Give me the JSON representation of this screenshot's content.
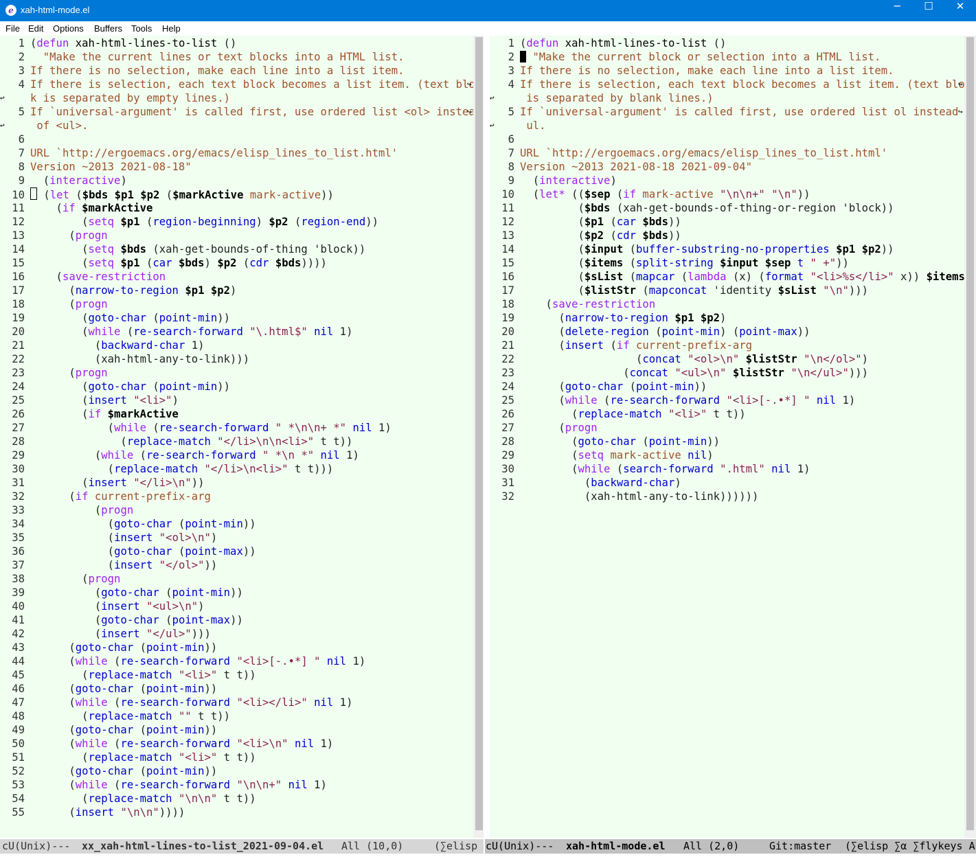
{
  "window": {
    "title": "xah-html-mode.el",
    "icon": "emacs-icon",
    "buttons": {
      "minimize": "─",
      "maximize": "☐",
      "close": "✕"
    }
  },
  "menubar": [
    "File",
    "Edit",
    "Options",
    "Buffers",
    "Tools",
    "Help"
  ],
  "left": {
    "lines": [
      {
        "n": "1",
        "h": "(<span class=\"k\">defun</span> <span class=\"f\">xah-html-lines-to-list</span> ()"
      },
      {
        "n": "2",
        "h": "  <span class=\"d\">\"Make the current lines or text blocks into a HTML list.</span>"
      },
      {
        "n": "3",
        "h": "<span class=\"d\">If there is no selection, make each line into a list item.</span>"
      },
      {
        "n": "4",
        "h": "<span class=\"d\">If there is selection, each text block becomes a list item. (text bloc</span>"
      },
      {
        "n": "",
        "h": "<span class=\"d\">k is separated by empty lines.)</span>"
      },
      {
        "n": "5",
        "h": "<span class=\"d\">If `universal-argument' is called first, use ordered list &lt;ol&gt; instead</span>"
      },
      {
        "n": "",
        "h": "<span class=\"d\"> of &lt;ul&gt;.</span>"
      },
      {
        "n": "6",
        "h": ""
      },
      {
        "n": "7",
        "h": "<span class=\"d\">URL `http://ergoemacs.org/emacs/elisp_lines_to_list.html'</span>"
      },
      {
        "n": "8",
        "h": "<span class=\"d\">Version ~2013 2021-08-18\"</span>"
      },
      {
        "n": "9",
        "h": "  (<span class=\"k\">interactive</span>)"
      },
      {
        "n": "10",
        "h": "<span class=\"cursor-box\"></span> (<span class=\"k\">let</span> (<span class=\"v\">$bds $p1 $p2</span> (<span class=\"v\">$markActive</span> <span class=\"d\">mark-active</span>))"
      },
      {
        "n": "11",
        "h": "    (<span class=\"k\">if</span> <span class=\"v\">$markActive</span>"
      },
      {
        "n": "12",
        "h": "        (<span class=\"k\">setq</span> <span class=\"v\">$p1</span> (<span class=\"b\">region-beginning</span>) <span class=\"v\">$p2</span> (<span class=\"b\">region-end</span>))"
      },
      {
        "n": "13",
        "h": "      (<span class=\"k\">progn</span>"
      },
      {
        "n": "14",
        "h": "        (<span class=\"k\">setq</span> <span class=\"v\">$bds</span> (xah-get-bounds-of-thing 'block))"
      },
      {
        "n": "15",
        "h": "        (<span class=\"k\">setq</span> <span class=\"v\">$p1</span> (<span class=\"b\">car</span> <span class=\"v\">$bds</span>) <span class=\"v\">$p2</span> (<span class=\"b\">cdr</span> <span class=\"v\">$bds</span>))))"
      },
      {
        "n": "16",
        "h": "    (<span class=\"k\">save-restriction</span>"
      },
      {
        "n": "17",
        "h": "      (<span class=\"b\">narrow-to-region</span> <span class=\"v\">$p1 $p2</span>)"
      },
      {
        "n": "18",
        "h": "      (<span class=\"k\">progn</span>"
      },
      {
        "n": "19",
        "h": "        (<span class=\"b\">goto-char</span> (<span class=\"b\">point-min</span>))"
      },
      {
        "n": "20",
        "h": "        (<span class=\"k\">while</span> (<span class=\"b\">re-search-forward</span> <span class=\"s\">\"\\.html$\"</span> <span class=\"b\">nil</span> 1)"
      },
      {
        "n": "21",
        "h": "          (<span class=\"b\">backward-char</span> 1)"
      },
      {
        "n": "22",
        "h": "          (xah-html-any-to-link)))"
      },
      {
        "n": "23",
        "h": "      (<span class=\"k\">progn</span>"
      },
      {
        "n": "24",
        "h": "        (<span class=\"b\">goto-char</span> (<span class=\"b\">point-min</span>))"
      },
      {
        "n": "25",
        "h": "        (<span class=\"b\">insert</span> <span class=\"s\">\"&lt;li&gt;\"</span>)"
      },
      {
        "n": "26",
        "h": "        (<span class=\"k\">if</span> <span class=\"v\">$markActive</span>"
      },
      {
        "n": "27",
        "h": "            (<span class=\"k\">while</span> (<span class=\"b\">re-search-forward</span> <span class=\"s\">\" *\\n\\n+ *\"</span> <span class=\"b\">nil</span> 1)"
      },
      {
        "n": "28",
        "h": "              (<span class=\"b\">replace-match</span> <span class=\"s\">\"&lt;/li&gt;\\n\\n&lt;li&gt;\"</span> t t))"
      },
      {
        "n": "29",
        "h": "          (<span class=\"k\">while</span> (<span class=\"b\">re-search-forward</span> <span class=\"s\">\" *\\n *\"</span> <span class=\"b\">nil</span> 1)"
      },
      {
        "n": "30",
        "h": "            (<span class=\"b\">replace-match</span> <span class=\"s\">\"&lt;/li&gt;\\n&lt;li&gt;\"</span> t t)))"
      },
      {
        "n": "31",
        "h": "        (<span class=\"b\">insert</span> <span class=\"s\">\"&lt;/li&gt;\\n\"</span>))"
      },
      {
        "n": "32",
        "h": "      (<span class=\"k\">if</span> <span class=\"d\">current-prefix-arg</span>"
      },
      {
        "n": "33",
        "h": "          (<span class=\"k\">progn</span>"
      },
      {
        "n": "34",
        "h": "            (<span class=\"b\">goto-char</span> (<span class=\"b\">point-min</span>))"
      },
      {
        "n": "35",
        "h": "            (<span class=\"b\">insert</span> <span class=\"s\">\"&lt;ol&gt;\\n\"</span>)"
      },
      {
        "n": "36",
        "h": "            (<span class=\"b\">goto-char</span> (<span class=\"b\">point-max</span>))"
      },
      {
        "n": "37",
        "h": "            (<span class=\"b\">insert</span> <span class=\"s\">\"&lt;/ol&gt;\"</span>))"
      },
      {
        "n": "38",
        "h": "        (<span class=\"k\">progn</span>"
      },
      {
        "n": "39",
        "h": "          (<span class=\"b\">goto-char</span> (<span class=\"b\">point-min</span>))"
      },
      {
        "n": "40",
        "h": "          (<span class=\"b\">insert</span> <span class=\"s\">\"&lt;ul&gt;\\n\"</span>)"
      },
      {
        "n": "41",
        "h": "          (<span class=\"b\">goto-char</span> (<span class=\"b\">point-max</span>))"
      },
      {
        "n": "42",
        "h": "          (<span class=\"b\">insert</span> <span class=\"s\">\"&lt;/ul&gt;\"</span>)))"
      },
      {
        "n": "43",
        "h": "      (<span class=\"b\">goto-char</span> (<span class=\"b\">point-min</span>))"
      },
      {
        "n": "44",
        "h": "      (<span class=\"k\">while</span> (<span class=\"b\">re-search-forward</span> <span class=\"s\">\"&lt;li&gt;[-.•*] \"</span> <span class=\"b\">nil</span> 1)"
      },
      {
        "n": "45",
        "h": "        (<span class=\"b\">replace-match</span> <span class=\"s\">\"&lt;li&gt;\"</span> t t))"
      },
      {
        "n": "46",
        "h": "      (<span class=\"b\">goto-char</span> (<span class=\"b\">point-min</span>))"
      },
      {
        "n": "47",
        "h": "      (<span class=\"k\">while</span> (<span class=\"b\">re-search-forward</span> <span class=\"s\">\"&lt;li&gt;&lt;/li&gt;\"</span> <span class=\"b\">nil</span> 1)"
      },
      {
        "n": "48",
        "h": "        (<span class=\"b\">replace-match</span> <span class=\"s\">\"\"</span> t t))"
      },
      {
        "n": "49",
        "h": "      (<span class=\"b\">goto-char</span> (<span class=\"b\">point-min</span>))"
      },
      {
        "n": "50",
        "h": "      (<span class=\"k\">while</span> (<span class=\"b\">re-search-forward</span> <span class=\"s\">\"&lt;li&gt;\\n\"</span> <span class=\"b\">nil</span> 1)"
      },
      {
        "n": "51",
        "h": "        (<span class=\"b\">replace-match</span> <span class=\"s\">\"&lt;li&gt;\"</span> t t))"
      },
      {
        "n": "52",
        "h": "      (<span class=\"b\">goto-char</span> (<span class=\"b\">point-min</span>))"
      },
      {
        "n": "53",
        "h": "      (<span class=\"k\">while</span> (<span class=\"b\">re-search-forward</span> <span class=\"s\">\"\\n\\n+\"</span> <span class=\"b\">nil</span> 1)"
      },
      {
        "n": "54",
        "h": "        (<span class=\"b\">replace-match</span> <span class=\"s\">\"\\n\\n\"</span> t t))"
      },
      {
        "n": "55",
        "h": "      (<span class=\"b\">insert</span> <span class=\"s\">\"\\n\\n\"</span>))))"
      }
    ],
    "modeline": {
      "status": "cU(Unix)---",
      "buffer": "xx_xah-html-lines-to-list_2021-09-04.el",
      "position": "All (10,0)",
      "mode": "(∑elisp"
    }
  },
  "right": {
    "lines": [
      {
        "n": "1",
        "h": "(<span class=\"k\">defun</span> <span class=\"f\">xah-html-lines-to-list</span> ()"
      },
      {
        "n": "2",
        "h": "<span class=\"cursor-solid\"></span> <span class=\"d\">\"Make the current block or selection into a HTML list.</span>"
      },
      {
        "n": "3",
        "h": "<span class=\"d\">If there is no selection, make each line into a list item.</span>"
      },
      {
        "n": "4",
        "h": "<span class=\"d\">If there is selection, each text block becomes a list item. (text block</span>"
      },
      {
        "n": "",
        "h": "<span class=\"d\"> is separated by blank lines.)</span>"
      },
      {
        "n": "5",
        "h": "<span class=\"d\">If `universal-argument' is called first, use ordered list ol instead of</span>"
      },
      {
        "n": "",
        "h": "<span class=\"d\"> ul.</span>"
      },
      {
        "n": "6",
        "h": ""
      },
      {
        "n": "7",
        "h": "<span class=\"d\">URL `http://ergoemacs.org/emacs/elisp_lines_to_list.html'</span>"
      },
      {
        "n": "8",
        "h": "<span class=\"d\">Version ~2013 2021-08-18 2021-09-04\"</span>"
      },
      {
        "n": "9",
        "h": "  (<span class=\"k\">interactive</span>)"
      },
      {
        "n": "10",
        "h": "  (<span class=\"k\">let*</span> ((<span class=\"v\">$sep</span> (<span class=\"k\">if</span> <span class=\"d\">mark-active</span> <span class=\"s\">\"\\n\\n+\"</span> <span class=\"s\">\"\\n\"</span>))"
      },
      {
        "n": "11",
        "h": "         (<span class=\"v\">$bds</span> (xah-get-bounds-of-thing-or-region 'block))"
      },
      {
        "n": "12",
        "h": "         (<span class=\"v\">$p1</span> (<span class=\"b\">car</span> <span class=\"v\">$bds</span>))"
      },
      {
        "n": "13",
        "h": "         (<span class=\"v\">$p2</span> (<span class=\"b\">cdr</span> <span class=\"v\">$bds</span>))"
      },
      {
        "n": "14",
        "h": "         (<span class=\"v\">$input</span> (<span class=\"b\">buffer-substring-no-properties</span> <span class=\"v\">$p1 $p2</span>))"
      },
      {
        "n": "15",
        "h": "         (<span class=\"v\">$items</span> (<span class=\"b\">split-string</span> <span class=\"v\">$input $sep</span> <span class=\"b\">t</span> <span class=\"s\">\" +\"</span>))"
      },
      {
        "n": "16",
        "h": "         (<span class=\"v\">$sList</span> (<span class=\"b\">mapcar</span> (<span class=\"k\">lambda</span> (x) (<span class=\"b\">format</span> <span class=\"s\">\"&lt;li&gt;%s&lt;/li&gt;\"</span> x)) <span class=\"v\">$items</span>))"
      },
      {
        "n": "17",
        "h": "         (<span class=\"v\">$listStr</span> (<span class=\"b\">mapconcat</span> 'identity <span class=\"v\">$sList</span> <span class=\"s\">\"\\n\"</span>)))"
      },
      {
        "n": "18",
        "h": "    (<span class=\"k\">save-restriction</span>"
      },
      {
        "n": "19",
        "h": "      (<span class=\"b\">narrow-to-region</span> <span class=\"v\">$p1 $p2</span>)"
      },
      {
        "n": "20",
        "h": "      (<span class=\"b\">delete-region</span> (<span class=\"b\">point-min</span>) (<span class=\"b\">point-max</span>))"
      },
      {
        "n": "21",
        "h": "      (<span class=\"b\">insert</span> (<span class=\"k\">if</span> <span class=\"d\">current-prefix-arg</span>"
      },
      {
        "n": "22",
        "h": "                  (<span class=\"b\">concat</span> <span class=\"s\">\"&lt;ol&gt;\\n\"</span> <span class=\"v\">$listStr</span> <span class=\"s\">\"\\n&lt;/ol&gt;\"</span>)"
      },
      {
        "n": "23",
        "h": "                (<span class=\"b\">concat</span> <span class=\"s\">\"&lt;ul&gt;\\n\"</span> <span class=\"v\">$listStr</span> <span class=\"s\">\"\\n&lt;/ul&gt;\"</span>)))"
      },
      {
        "n": "24",
        "h": "      (<span class=\"b\">goto-char</span> (<span class=\"b\">point-min</span>))"
      },
      {
        "n": "25",
        "h": "      (<span class=\"k\">while</span> (<span class=\"b\">re-search-forward</span> <span class=\"s\">\"&lt;li&gt;[-.•*] \"</span> <span class=\"b\">nil</span> 1)"
      },
      {
        "n": "26",
        "h": "        (<span class=\"b\">replace-match</span> <span class=\"s\">\"&lt;li&gt;\"</span> t t))"
      },
      {
        "n": "27",
        "h": "      (<span class=\"k\">progn</span>"
      },
      {
        "n": "28",
        "h": "        (<span class=\"b\">goto-char</span> (<span class=\"b\">point-min</span>))"
      },
      {
        "n": "29",
        "h": "        (<span class=\"k\">setq</span> <span class=\"d\">mark-active</span> <span class=\"b\">nil</span>)"
      },
      {
        "n": "30",
        "h": "        (<span class=\"k\">while</span> (<span class=\"b\">search-forward</span> <span class=\"s\">\".html\"</span> <span class=\"b\">nil</span> 1)"
      },
      {
        "n": "31",
        "h": "          (<span class=\"b\">backward-char</span>)"
      },
      {
        "n": "32",
        "h": "          (xah-html-any-to-link))))))"
      }
    ],
    "modeline": {
      "status": "cU(Unix)---",
      "buffer": "xah-html-mode.el",
      "position": "All (2,0)",
      "vc": "Git:master",
      "mode": "(∑elisp ∑α ∑flykeys A"
    }
  }
}
